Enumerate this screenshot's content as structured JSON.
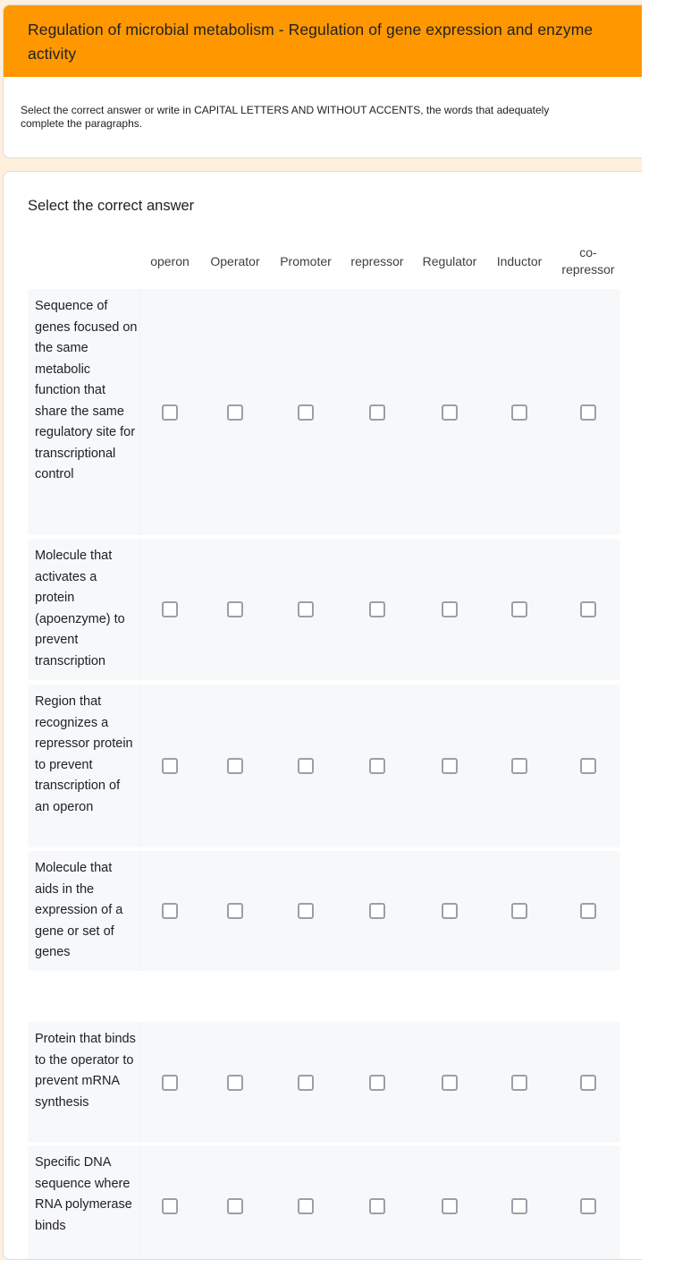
{
  "form": {
    "title": "Regulation of microbial metabolism - Regulation of gene expression and enzyme activity",
    "description": "Select the correct answer or write in CAPITAL LETTERS AND WITHOUT ACCENTS, the words that adequately complete the paragraphs.",
    "header_color": "#ff9800",
    "background_color": "#fff0dd"
  },
  "question": {
    "title": "Select the correct answer",
    "columns": [
      "operon",
      "Operator",
      "Promoter",
      "repressor",
      "Regulator",
      "Inductor",
      "co-repressor"
    ],
    "rows": [
      {
        "label": "Sequence of genes focused on the same metabolic function that share the same regulatory site for transcriptional control",
        "checked": [
          false,
          false,
          false,
          false,
          false,
          false,
          false
        ]
      },
      {
        "label": "Molecule that activates a protein (apoenzyme) to prevent transcription",
        "checked": [
          false,
          false,
          false,
          false,
          false,
          false,
          false
        ]
      },
      {
        "label": "Region that recognizes a repressor protein to prevent transcription of an operon",
        "checked": [
          false,
          false,
          false,
          false,
          false,
          false,
          false
        ]
      },
      {
        "label": "Molecule that aids in the expression of a gene or set of genes",
        "checked": [
          false,
          false,
          false,
          false,
          false,
          false,
          false
        ]
      },
      {
        "label": "Protein that binds to the operator to prevent mRNA synthesis",
        "checked": [
          false,
          false,
          false,
          false,
          false,
          false,
          false
        ]
      },
      {
        "label": "Specific DNA sequence where RNA polymerase binds",
        "checked": [
          false,
          false,
          false,
          false,
          false,
          false,
          false
        ]
      }
    ]
  }
}
